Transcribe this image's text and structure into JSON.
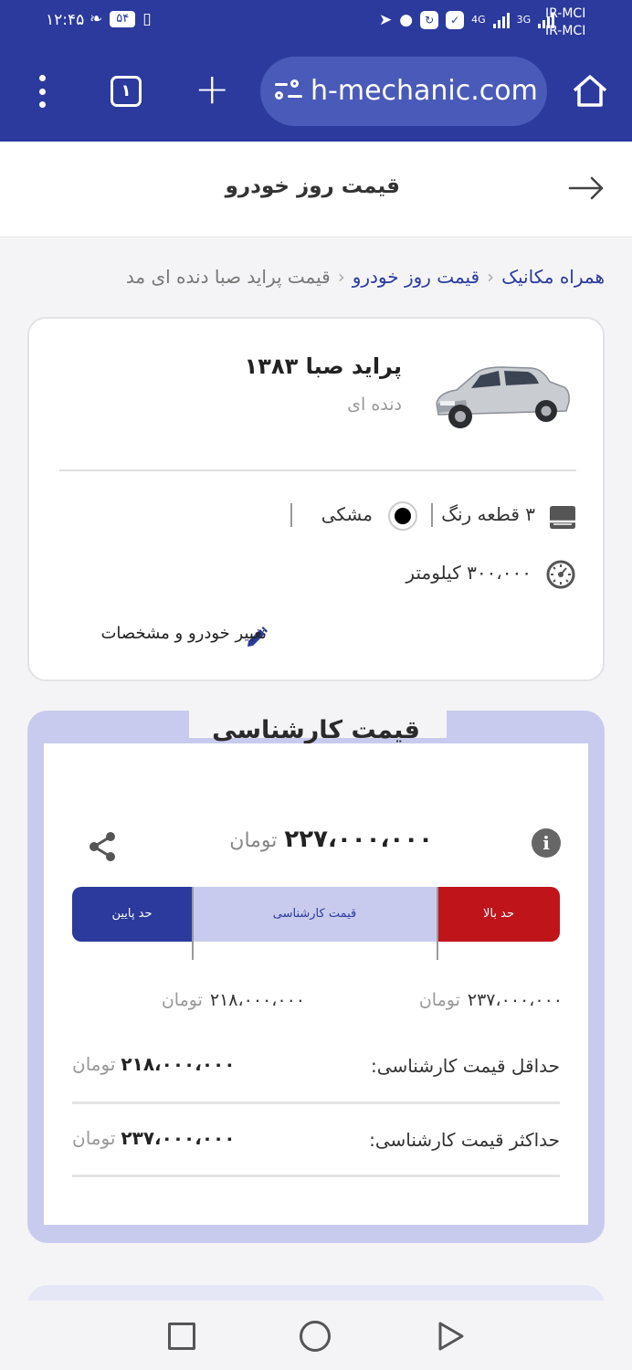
{
  "status_bar": {
    "time": "۱۲:۴۵",
    "battery": "۵۴",
    "network_1": "4G",
    "network_2": "3G",
    "carrier_1": "IR-MCI",
    "carrier_2": "IR-MCI"
  },
  "browser": {
    "tab_count": "۱",
    "url": "h-mechanic.com",
    "icons": [
      "more-vert-icon",
      "tab-switcher-icon",
      "plus-icon",
      "site-settings-icon",
      "home-icon"
    ]
  },
  "page_header": {
    "title": "قیمت روز خودرو"
  },
  "breadcrumb": {
    "items": [
      "همراه مکانیک",
      "قیمت روز خودرو",
      "قیمت پراید صبا دنده ای مد"
    ]
  },
  "car": {
    "title": "پراید صبا ۱۳۸۳",
    "subtitle": "دنده ای",
    "paint": "۳ قطعه رنگ",
    "color_name": "مشکی",
    "color_hex": "#000000",
    "mileage": "۳۰۰،۰۰۰ کیلومتر",
    "edit_label": "تغییر خودرو و مشخصات"
  },
  "price": {
    "title": "قیمت کارشناسی",
    "value": "۲۲۷،۰۰۰،۰۰۰",
    "unit": "تومان",
    "bar": {
      "low_label": "حد پایین",
      "mid_label": "قیمت کارشناسی",
      "high_label": "حد بالا"
    },
    "range_low": "۲۱۸،۰۰۰،۰۰۰",
    "range_high": "۲۳۷،۰۰۰،۰۰۰",
    "min_label": "حداقل قیمت کارشناسی:",
    "min_value": "۲۱۸،۰۰۰،۰۰۰",
    "max_label": "حداکثر قیمت کارشناسی:",
    "max_value": "۲۳۷،۰۰۰،۰۰۰"
  },
  "colors": {
    "brand": "#2b3a9c",
    "high": "#c0141b",
    "mid": "#c9cbee"
  }
}
